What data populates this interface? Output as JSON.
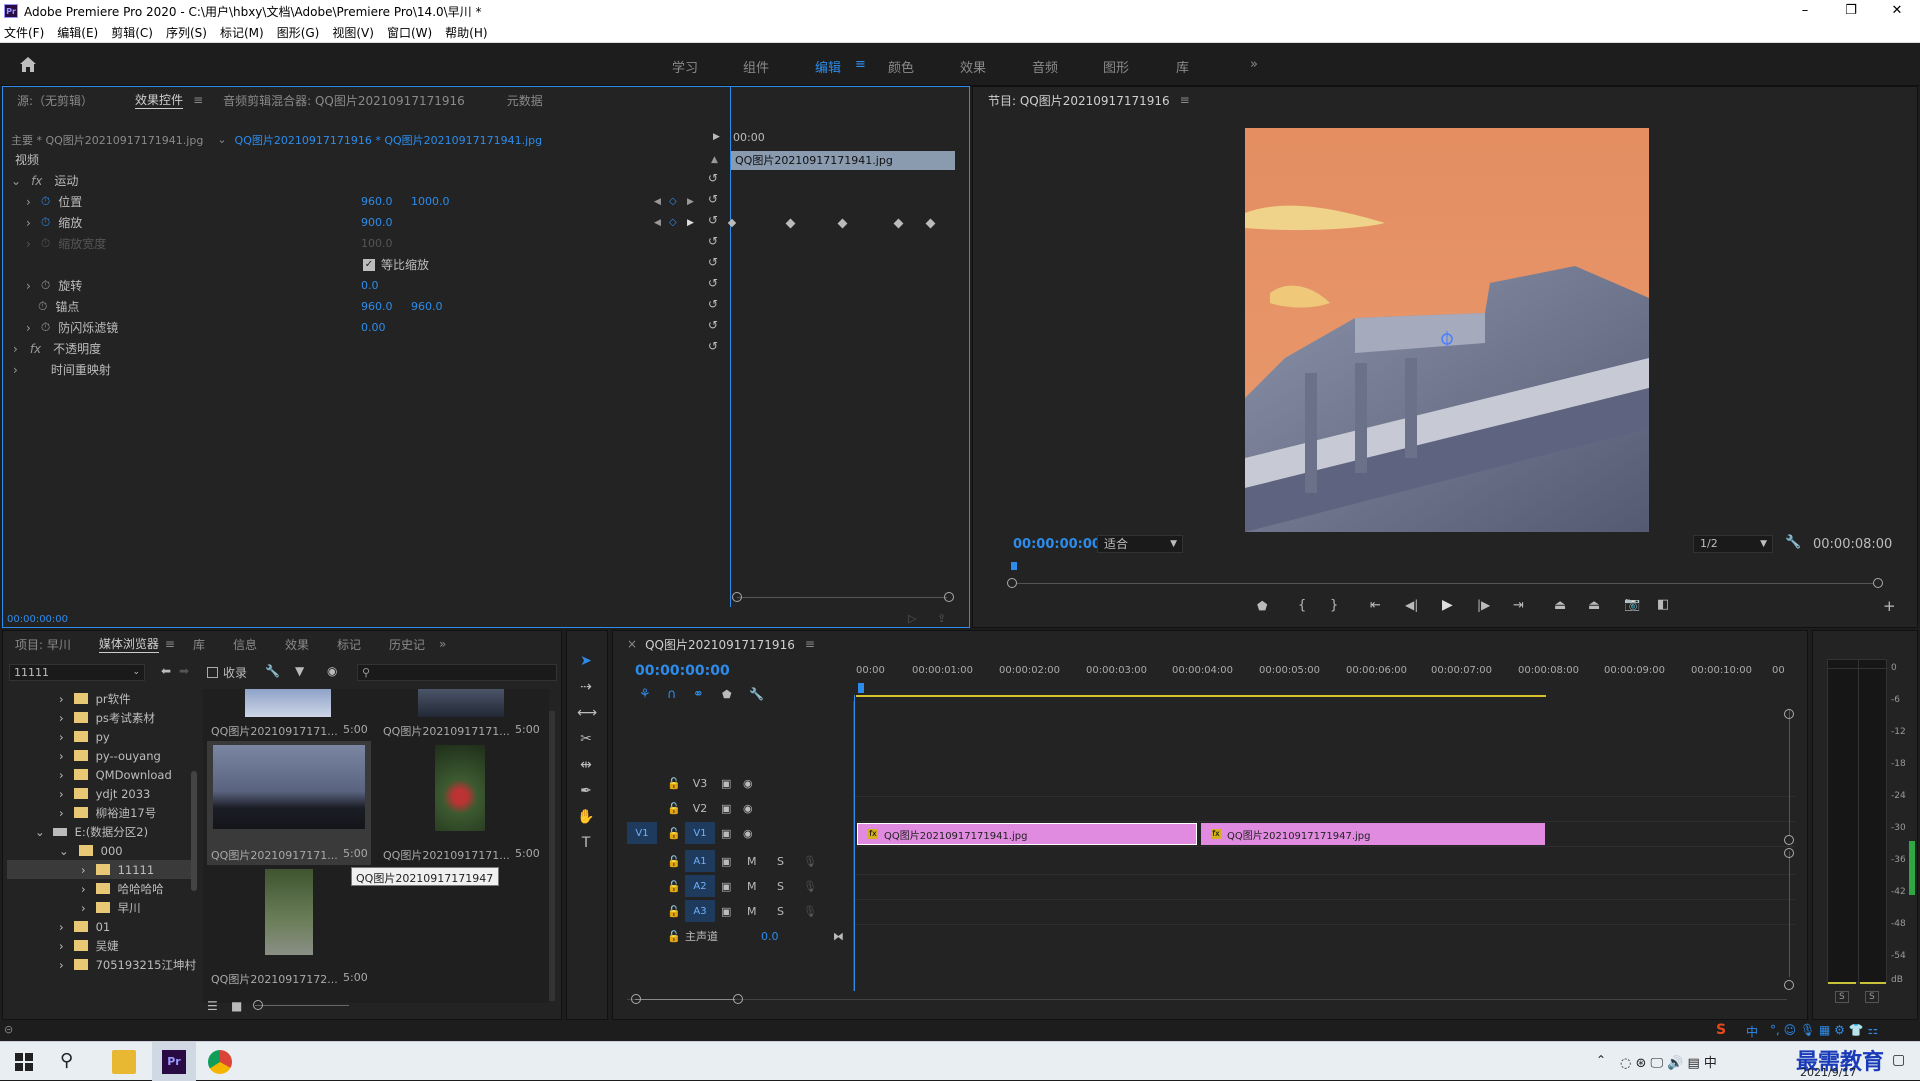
{
  "window": {
    "title": "Adobe Premiere Pro 2020 - C:\\用户\\hbxy\\文档\\Adobe\\Premiere Pro\\14.0\\早川 *",
    "minimize": "–",
    "maximize": "❐",
    "close": "✕"
  },
  "menu": [
    "文件(F)",
    "编辑(E)",
    "剪辑(C)",
    "序列(S)",
    "标记(M)",
    "图形(G)",
    "视图(V)",
    "窗口(W)",
    "帮助(H)"
  ],
  "workspaces": [
    {
      "label": "学习"
    },
    {
      "label": "组件"
    },
    {
      "label": "编辑",
      "active": true
    },
    {
      "label": "颜色"
    },
    {
      "label": "效果"
    },
    {
      "label": "音频"
    },
    {
      "label": "图形"
    },
    {
      "label": "库"
    }
  ],
  "workspaces_more": "»",
  "effect_panel": {
    "tabs": [
      "源:（无剪辑）",
      "效果控件",
      "音频剪辑混合器: QQ图片20210917171916",
      "元数据"
    ],
    "master": "主要 * QQ图片20210917171941.jpg",
    "sequence": "QQ图片20210917171916 * QQ图片20210917171941.jpg",
    "timecode_head": "00:00",
    "clip_name": "QQ图片20210917171941.jpg",
    "video": "视频",
    "motion": "运动",
    "position": {
      "label": "位置",
      "x": "960.0",
      "y": "1000.0"
    },
    "scale": {
      "label": "缩放",
      "value": "900.0"
    },
    "scale_width": {
      "label": "缩放宽度",
      "value": "100.0"
    },
    "uniform": "等比缩放",
    "rotation": {
      "label": "旋转",
      "value": "0.0"
    },
    "anchor": {
      "label": "锚点",
      "x": "960.0",
      "y": "960.0"
    },
    "flicker": {
      "label": "防闪烁滤镜",
      "value": "0.00"
    },
    "opacity": "不透明度",
    "timeremap": "时间重映射",
    "footer_time": "00:00:00:00"
  },
  "program": {
    "title": "节目: QQ图片20210917171916",
    "timecode": "00:00:00:00",
    "fit": "适合",
    "quality": "1/2",
    "duration": "00:00:08:00"
  },
  "project_panel": {
    "tabs": [
      "项目: 早川",
      "媒体浏览器",
      "库",
      "信息",
      "效果",
      "标记",
      "历史记"
    ],
    "path": "11111",
    "ingest": "收录",
    "tree": [
      {
        "label": "pr软件",
        "level": 1
      },
      {
        "label": "ps考试素材",
        "level": 1
      },
      {
        "label": "py",
        "level": 1
      },
      {
        "label": "py--ouyang",
        "level": 1
      },
      {
        "label": "QMDownload",
        "level": 1
      },
      {
        "label": "ydjt 2033",
        "level": 1
      },
      {
        "label": "柳裕迪17号",
        "level": 1
      },
      {
        "label": "E:(数据分区2)",
        "level": 0
      },
      {
        "label": "000",
        "level": 1
      },
      {
        "label": "11111",
        "level": 2
      },
      {
        "label": "哈哈哈哈",
        "level": 2
      },
      {
        "label": "早川",
        "level": 2
      },
      {
        "label": "01",
        "level": 1
      },
      {
        "label": "吴婕",
        "level": 1
      },
      {
        "label": "705193215江坤村",
        "level": 1
      }
    ],
    "thumbs": [
      {
        "name": "QQ图片20210917171...",
        "dur": "5:00"
      },
      {
        "name": "QQ图片20210917171...",
        "dur": "5:00"
      },
      {
        "name": "QQ图片20210917171...",
        "dur": "5:00"
      },
      {
        "name": "QQ图片20210917171...",
        "dur": "5:00"
      },
      {
        "name": "QQ图片20210917172...",
        "dur": "5:00"
      }
    ],
    "tooltip": "QQ图片20210917171947"
  },
  "timeline": {
    "title": "QQ图片20210917171916",
    "timecode": "00:00:00:00",
    "ruler": [
      "00:00",
      "00:00:01:00",
      "00:00:02:00",
      "00:00:03:00",
      "00:00:04:00",
      "00:00:05:00",
      "00:00:06:00",
      "00:00:07:00",
      "00:00:08:00",
      "00:00:09:00",
      "00:00:10:00",
      "00"
    ],
    "tracks": {
      "v3": "V3",
      "v2": "V2",
      "v1": "V1",
      "a1": "A1",
      "a2": "A2",
      "a3": "A3",
      "src": "V1",
      "m": "M",
      "s": "S",
      "master": "主声道",
      "master_val": "0.0"
    },
    "clip1": "QQ图片20210917171941.jpg",
    "clip2": "QQ图片20210917171947.jpg"
  },
  "meter": {
    "ticks": [
      "0",
      "-6",
      "-12",
      "-18",
      "-24",
      "-30",
      "-36",
      "-42",
      "-48",
      "-54",
      "dB"
    ],
    "solo": "S"
  },
  "taskbar": {
    "date": "2021/9/17",
    "watermark": "最需教育",
    "ime": "中"
  }
}
